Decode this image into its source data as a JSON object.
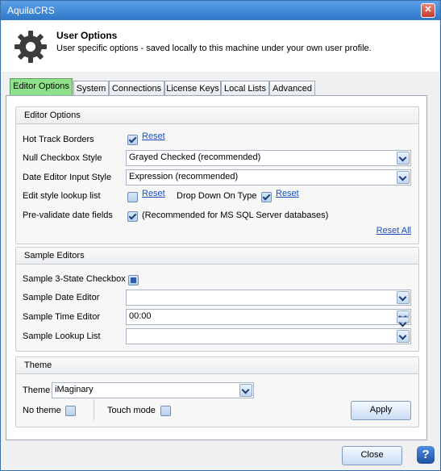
{
  "window": {
    "title": "AquilaCRS",
    "close_glyph": "✕"
  },
  "header": {
    "title": "User Options",
    "subtitle": "User specific options - saved locally to this machine under your own user profile."
  },
  "tabs": [
    {
      "label": "Editor Options",
      "active": true
    },
    {
      "label": "System"
    },
    {
      "label": "Connections"
    },
    {
      "label": "License Keys"
    },
    {
      "label": "Local Lists"
    },
    {
      "label": "Advanced"
    }
  ],
  "editor_options": {
    "title": "Editor Options",
    "hot_track_borders": {
      "label": "Hot Track Borders",
      "checked": true,
      "reset": "Reset"
    },
    "null_checkbox_style": {
      "label": "Null Checkbox Style",
      "value": "Grayed Checked (recommended)"
    },
    "date_editor_input_style": {
      "label": "Date Editor Input Style",
      "value": "Expression (recommended)"
    },
    "edit_style_lookup_list": {
      "label": "Edit style lookup list",
      "checked": false,
      "reset": "Reset"
    },
    "drop_down_on_type": {
      "label": "Drop Down On Type",
      "checked": true,
      "reset": "Reset"
    },
    "pre_validate_date_fields": {
      "label": "Pre-validate date fields",
      "checked": true,
      "note": "(Recommended for MS SQL Server databases)"
    },
    "reset_all": "Reset All"
  },
  "sample_editors": {
    "title": "Sample Editors",
    "three_state_checkbox": {
      "label": "Sample 3-State Checkbox"
    },
    "date_editor": {
      "label": "Sample Date Editor",
      "value": ""
    },
    "time_editor": {
      "label": "Sample Time Editor",
      "value": "00:00"
    },
    "lookup_list": {
      "label": "Sample Lookup List",
      "value": ""
    }
  },
  "theme": {
    "title": "Theme",
    "label": "Theme",
    "value": "iMaginary",
    "no_theme": {
      "label": "No theme",
      "checked": false
    },
    "touch_mode": {
      "label": "Touch mode",
      "checked": false
    },
    "apply": "Apply"
  },
  "footer": {
    "close": "Close",
    "help": "?"
  }
}
